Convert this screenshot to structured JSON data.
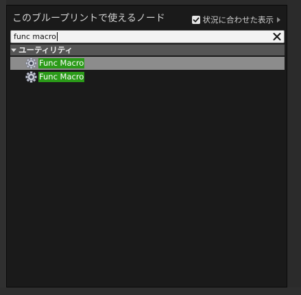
{
  "panel": {
    "title": "このブループリントで使えるノード",
    "context_sensitive": {
      "label": "状況に合わせた表示",
      "checked": true
    }
  },
  "search": {
    "value": "func macro",
    "placeholder": ""
  },
  "category": {
    "label": "ユーティリティ",
    "expanded": true
  },
  "nodes": [
    {
      "label": "Func Macro",
      "icon": "gear-icon",
      "selected": true
    },
    {
      "label": "Func Macro",
      "icon": "gear-icon",
      "selected": false
    }
  ],
  "colors": {
    "panel_bg": "#1a1a1a",
    "category_bg": "#555555",
    "selected_row": "#8c8c8c",
    "match_highlight": "#2a9a18"
  }
}
